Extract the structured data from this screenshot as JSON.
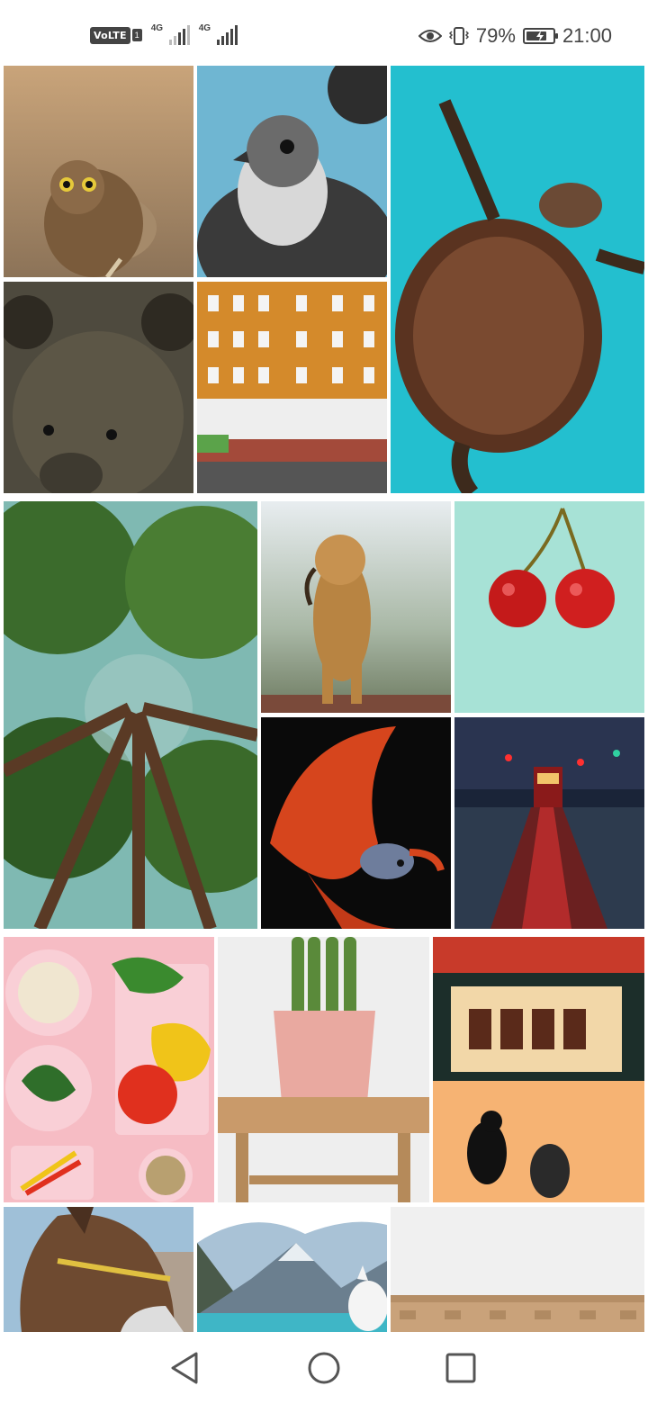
{
  "status_bar": {
    "volte_label": "VoLTE",
    "sim_slot": "1",
    "signal1_label": "4G",
    "signal2_label": "4G",
    "battery_percent": "79%",
    "battery_level": 0.79,
    "time": "21:00",
    "icons": [
      "eye-icon",
      "vibrate-icon",
      "battery-charging-icon"
    ]
  },
  "gallery": {
    "images": [
      {
        "subject": "owl"
      },
      {
        "subject": "falcon"
      },
      {
        "subject": "sea-turtle"
      },
      {
        "subject": "bear"
      },
      {
        "subject": "orange-building"
      },
      {
        "subject": "forest-canopy"
      },
      {
        "subject": "lioness"
      },
      {
        "subject": "cherries"
      },
      {
        "subject": "betta-fish"
      },
      {
        "subject": "tram-night-street"
      },
      {
        "subject": "vegetables-on-pink"
      },
      {
        "subject": "potted-plant-on-stool"
      },
      {
        "subject": "night-food-stall"
      },
      {
        "subject": "donkey"
      },
      {
        "subject": "mountain-lake-dog"
      },
      {
        "subject": "building-rooftop"
      }
    ]
  },
  "nav_bar": {
    "buttons": [
      "back-icon",
      "home-icon",
      "recents-icon"
    ]
  },
  "colors": {
    "icon": "#444444",
    "nav_icon": "#555555"
  }
}
